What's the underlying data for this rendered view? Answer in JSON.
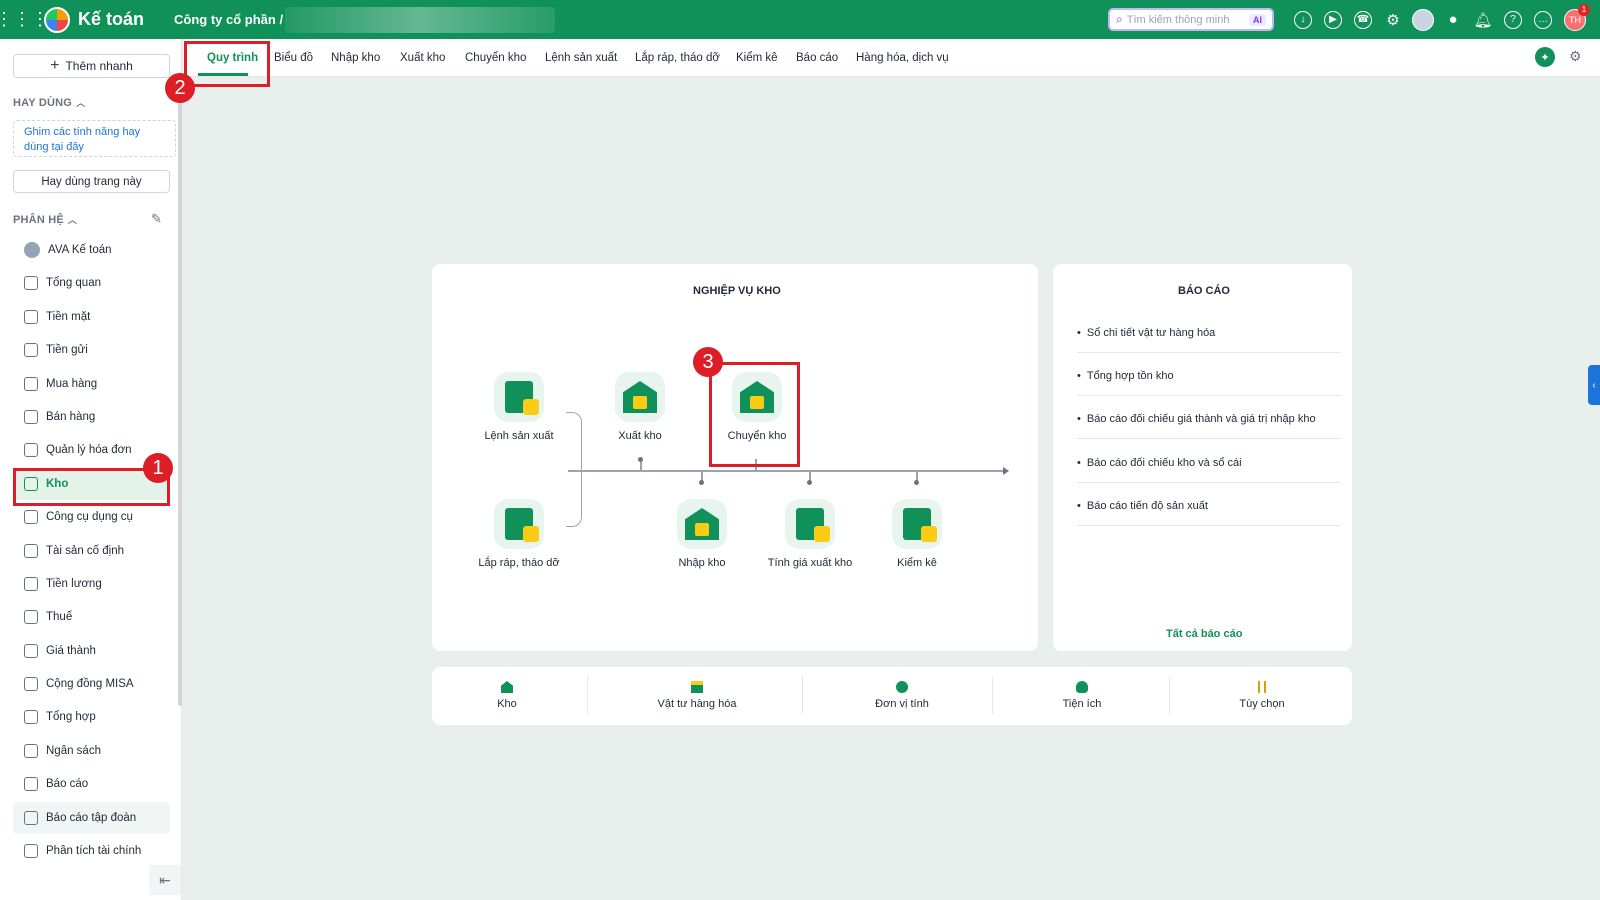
{
  "topbar": {
    "app_name": "Kế toán",
    "company": "Công ty cổ phần /",
    "search_placeholder": "Tìm kiếm thông minh",
    "search_ai_badge": "AI",
    "user_initials": "TH",
    "notification_count": "1"
  },
  "sidebar": {
    "add_quick_label": "Thêm nhanh",
    "frequent_section": "HAY DÙNG",
    "pin_hint": "Ghim các tính năng hay dùng tại đây",
    "frequent_page_button": "Hay dùng trang này",
    "modules_section": "PHÂN HỆ",
    "items": [
      {
        "label": "AVA Kế toán",
        "icon": "ava-avatar-icon"
      },
      {
        "label": "Tổng quan",
        "icon": "dashboard-icon"
      },
      {
        "label": "Tiền mặt",
        "icon": "cash-icon"
      },
      {
        "label": "Tiền gửi",
        "icon": "bank-icon"
      },
      {
        "label": "Mua hàng",
        "icon": "shopping-bag-icon"
      },
      {
        "label": "Bán hàng",
        "icon": "cart-icon"
      },
      {
        "label": "Quản lý hóa đơn",
        "icon": "invoice-icon"
      },
      {
        "label": "Kho",
        "icon": "warehouse-icon"
      },
      {
        "label": "Công cụ dụng cụ",
        "icon": "tools-icon"
      },
      {
        "label": "Tài sản cố định",
        "icon": "truck-icon"
      },
      {
        "label": "Tiền lương",
        "icon": "salary-icon"
      },
      {
        "label": "Thuế",
        "icon": "tax-icon"
      },
      {
        "label": "Giá thành",
        "icon": "price-tag-icon"
      },
      {
        "label": "Cộng đồng MISA",
        "icon": "community-icon"
      },
      {
        "label": "Tổng hợp",
        "icon": "summary-icon"
      },
      {
        "label": "Ngân sách",
        "icon": "budget-icon"
      },
      {
        "label": "Báo cáo",
        "icon": "report-icon"
      },
      {
        "label": "Báo cáo tập đoàn",
        "icon": "group-report-icon"
      },
      {
        "label": "Phân tích tài chính",
        "icon": "analysis-icon"
      }
    ],
    "active_item": "Kho"
  },
  "tabs": [
    {
      "label": "Quy trình",
      "active": true
    },
    {
      "label": "Biểu đồ"
    },
    {
      "label": "Nhập kho"
    },
    {
      "label": "Xuất kho"
    },
    {
      "label": "Chuyển kho"
    },
    {
      "label": "Lệnh sản xuất"
    },
    {
      "label": "Lắp ráp, tháo dỡ"
    },
    {
      "label": "Kiểm kê"
    },
    {
      "label": "Báo cáo"
    },
    {
      "label": "Hàng hóa, dịch vụ"
    }
  ],
  "workflow": {
    "title": "NGHIỆP VỤ KHO",
    "nodes": {
      "production_order": "Lệnh sản xuất",
      "assembly": "Lắp ráp, tháo dỡ",
      "stock_out": "Xuất kho",
      "transfer": "Chuyển kho",
      "stock_in": "Nhập kho",
      "costing": "Tính giá xuất kho",
      "inventory_check": "Kiểm kê"
    }
  },
  "reports": {
    "title": "BÁO CÁO",
    "items": [
      "Sổ chi tiết vật tư hàng hóa",
      "Tổng hợp tồn kho",
      "Báo cáo đối chiếu giá thành và giá trị nhập kho",
      "Báo cáo đối chiếu kho và sổ cái",
      "Báo cáo tiến độ sản xuất"
    ],
    "all_link": "Tất cả báo cáo"
  },
  "bottom_bar": [
    {
      "label": "Kho",
      "icon": "warehouse-icon",
      "color": "#11915a"
    },
    {
      "label": "Vật tư hàng hóa",
      "icon": "box-icon",
      "color": "#11915a"
    },
    {
      "label": "Đơn vị tính",
      "icon": "unit-icon",
      "color": "#11915a"
    },
    {
      "label": "Tiện ích",
      "icon": "bulb-icon",
      "color": "#11915a"
    },
    {
      "label": "Tùy chọn",
      "icon": "options-icon",
      "color": "#d4a106"
    }
  ],
  "annotations": [
    "1",
    "2",
    "3"
  ],
  "colors": {
    "brand": "#11915a",
    "highlight": "#dc1f26",
    "link": "#1d74d8"
  }
}
